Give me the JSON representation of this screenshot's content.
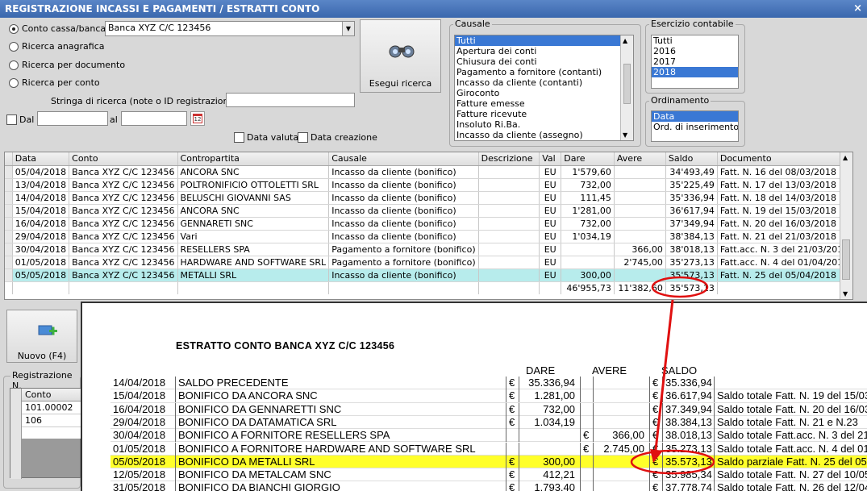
{
  "window": {
    "title": "REGISTRAZIONE INCASSI E PAGAMENTI / ESTRATTI CONTO",
    "close": "×"
  },
  "search": {
    "radios": [
      {
        "label": "Conto cassa/banca",
        "checked": true
      },
      {
        "label": "Ricerca anagrafica",
        "checked": false
      },
      {
        "label": "Ricerca per documento",
        "checked": false
      },
      {
        "label": "Ricerca per conto",
        "checked": false
      }
    ],
    "account_value": "Banca XYZ C/C 123456",
    "string_label": "Stringa di ricerca (note o ID registrazione) :",
    "string_value": "",
    "dal_label": "Dal",
    "al_label": "al",
    "data_valuta_label": "Data valuta",
    "data_creazione_label": "Data creazione",
    "run_button": "Esegui ricerca",
    "calendar_day": "12"
  },
  "causale": {
    "title": "Causale",
    "items": [
      "Tutti",
      "Apertura dei conti",
      "Chiusura dei conti",
      "Pagamento a fornitore (contanti)",
      "Incasso da cliente (contanti)",
      "Giroconto",
      "Fatture emesse",
      "Fatture ricevute",
      "Insoluto Ri.Ba.",
      "Incasso da cliente (assegno)"
    ],
    "selected": 0
  },
  "esercizio": {
    "title": "Esercizio contabile",
    "items": [
      "Tutti",
      "2016",
      "2017",
      "2018"
    ],
    "selected": 3
  },
  "ordinamento": {
    "title": "Ordinamento",
    "items": [
      "Data",
      "Ord. di inserimento"
    ],
    "selected": 0
  },
  "grid": {
    "columns": [
      "Data",
      "Conto",
      "Contropartita",
      "Causale",
      "Descrizione",
      "Val",
      "Dare",
      "Avere",
      "Saldo",
      "Documento"
    ],
    "rows": [
      [
        "05/04/2018",
        "Banca XYZ C/C 123456",
        "ANCORA SNC",
        "Incasso da cliente (bonifico)",
        "",
        "EU",
        "1'579,60",
        "",
        "34'493,49",
        "Fatt. N. 16 del 08/03/2018"
      ],
      [
        "13/04/2018",
        "Banca XYZ C/C 123456",
        "POLTRONIFICIO OTTOLETTI SRL",
        "Incasso da cliente (bonifico)",
        "",
        "EU",
        "732,00",
        "",
        "35'225,49",
        "Fatt. N. 17 del 13/03/2018"
      ],
      [
        "14/04/2018",
        "Banca XYZ C/C 123456",
        "BELUSCHI GIOVANNI SAS",
        "Incasso da cliente (bonifico)",
        "",
        "EU",
        "111,45",
        "",
        "35'336,94",
        "Fatt. N. 18 del 14/03/2018"
      ],
      [
        "15/04/2018",
        "Banca XYZ C/C 123456",
        "ANCORA SNC",
        "Incasso da cliente (bonifico)",
        "",
        "EU",
        "1'281,00",
        "",
        "36'617,94",
        "Fatt. N. 19 del 15/03/2018"
      ],
      [
        "16/04/2018",
        "Banca XYZ C/C 123456",
        "GENNARETI SNC",
        "Incasso da cliente (bonifico)",
        "",
        "EU",
        "732,00",
        "",
        "37'349,94",
        "Fatt. N. 20 del 16/03/2018"
      ],
      [
        "29/04/2018",
        "Banca XYZ C/C 123456",
        "Vari",
        "Incasso da cliente (bonifico)",
        "",
        "EU",
        "1'034,19",
        "",
        "38'384,13",
        "Fatt. N. 21 del 21/03/2018"
      ],
      [
        "30/04/2018",
        "Banca XYZ C/C 123456",
        "RESELLERS SPA",
        "Pagamento a fornitore (bonifico)",
        "",
        "EU",
        "",
        "366,00",
        "38'018,13",
        "Fatt.acc. N. 3 del 21/03/2018"
      ],
      [
        "01/05/2018",
        "Banca XYZ C/C 123456",
        "HARDWARE AND SOFTWARE SRL",
        "Pagamento a fornitore (bonifico)",
        "",
        "EU",
        "",
        "2'745,00",
        "35'273,13",
        "Fatt.acc. N. 4 del 01/04/2018"
      ],
      [
        "05/05/2018",
        "Banca XYZ C/C 123456",
        "METALLI SRL",
        "Incasso da cliente (bonifico)",
        "",
        "EU",
        "300,00",
        "",
        "35'573,13",
        "Fatt. N. 25 del 05/04/2018"
      ]
    ],
    "selected_row": 8,
    "totals": {
      "dare": "46'955,73",
      "avere": "11'382,60",
      "saldo": "35'573,13"
    }
  },
  "left_panel": {
    "new_button": "Nuovo (F4)",
    "reg_label": "Registrazione N.",
    "conto_header": "Conto",
    "conto_rows": [
      "101.00002",
      "106"
    ]
  },
  "statement": {
    "title": "ESTRATTO CONTO BANCA XYZ C/C 123456",
    "headers": {
      "dare": "DARE",
      "avere": "AVERE",
      "saldo": "SALDO"
    },
    "rows": [
      {
        "date": "14/04/2018",
        "desc": "SALDO PRECEDENTE",
        "dcur": "€",
        "dare": "35.336,94",
        "acur": "",
        "avere": "",
        "scur": "€",
        "saldo": "35.336,94",
        "note": ""
      },
      {
        "date": "15/04/2018",
        "desc": "BONIFICO DA ANCORA SNC",
        "dcur": "€",
        "dare": "1.281,00",
        "acur": "",
        "avere": "",
        "scur": "€",
        "saldo": "36.617,94",
        "note": "Saldo totale Fatt. N. 19 del 15/03"
      },
      {
        "date": "16/04/2018",
        "desc": "BONIFICO DA GENNARETTI SNC",
        "dcur": "€",
        "dare": "732,00",
        "acur": "",
        "avere": "",
        "scur": "€",
        "saldo": "37.349,94",
        "note": "Saldo totale Fatt. N. 20 del 16/03"
      },
      {
        "date": "29/04/2018",
        "desc": "BONIFICO DA DATAMATICA SRL",
        "dcur": "€",
        "dare": "1.034,19",
        "acur": "",
        "avere": "",
        "scur": "€",
        "saldo": "38.384,13",
        "note": "Saldo totale Fatt. N. 21 e N.23"
      },
      {
        "date": "30/04/2018",
        "desc": "BONIFICO A FORNITORE RESELLERS SPA",
        "dcur": "",
        "dare": "",
        "acur": "€",
        "avere": "366,00",
        "scur": "€",
        "saldo": "38.018,13",
        "note": "Saldo totale Fatt.acc. N. 3 del 21"
      },
      {
        "date": "01/05/2018",
        "desc": "BONIFICO A FORNITORE HARDWARE AND SOFTWARE SRL",
        "dcur": "",
        "dare": "",
        "acur": "€",
        "avere": "2.745,00",
        "scur": "€",
        "saldo": "35.273,13",
        "note": "Saldo totale Fatt.acc. N. 4 del 01"
      },
      {
        "date": "05/05/2018",
        "desc": "BONIFICO DA METALLI SRL",
        "dcur": "€",
        "dare": "300,00",
        "acur": "",
        "avere": "",
        "scur": "€",
        "saldo": "35.573,13",
        "note": "Saldo parziale Fatt. N. 25 del 05"
      },
      {
        "date": "12/05/2018",
        "desc": "BONIFICO DA METALCAM SNC",
        "dcur": "€",
        "dare": "412,21",
        "acur": "",
        "avere": "",
        "scur": "€",
        "saldo": "35.985,34",
        "note": "Saldo totale Fatt. N. 27 del 10/05"
      },
      {
        "date": "31/05/2018",
        "desc": "BONIFICO DA BIANCHI GIORGIO",
        "dcur": "€",
        "dare": "1.793,40",
        "acur": "",
        "avere": "",
        "scur": "€",
        "saldo": "37.778,74",
        "note": "Saldo totale Fatt. N. 26 del 12/04"
      }
    ],
    "highlight_row": 6
  },
  "colors": {
    "title": "#3a67ad",
    "select": "#3a78d4",
    "grid_select": "#b7ecec",
    "highlight": "#ffff2a",
    "annotation": "#e01010"
  }
}
